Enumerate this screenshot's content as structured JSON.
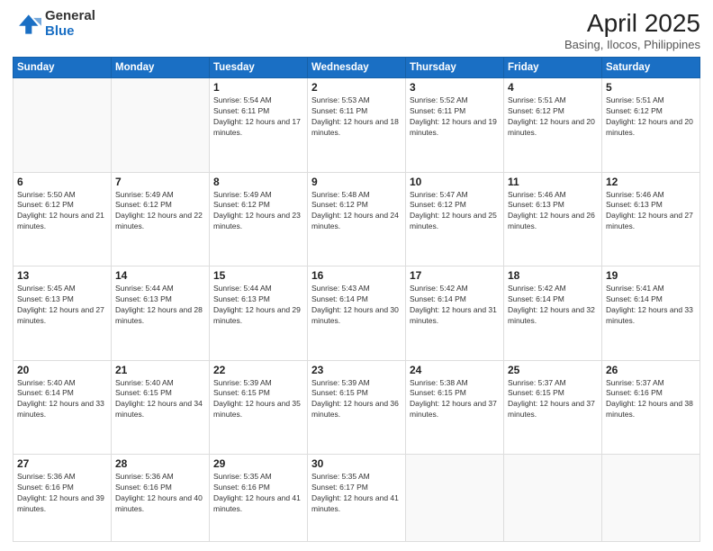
{
  "header": {
    "logo_general": "General",
    "logo_blue": "Blue",
    "title": "April 2025",
    "location": "Basing, Ilocos, Philippines"
  },
  "days_of_week": [
    "Sunday",
    "Monday",
    "Tuesday",
    "Wednesday",
    "Thursday",
    "Friday",
    "Saturday"
  ],
  "weeks": [
    [
      {
        "day": "",
        "detail": ""
      },
      {
        "day": "",
        "detail": ""
      },
      {
        "day": "1",
        "detail": "Sunrise: 5:54 AM\nSunset: 6:11 PM\nDaylight: 12 hours and 17 minutes."
      },
      {
        "day": "2",
        "detail": "Sunrise: 5:53 AM\nSunset: 6:11 PM\nDaylight: 12 hours and 18 minutes."
      },
      {
        "day": "3",
        "detail": "Sunrise: 5:52 AM\nSunset: 6:11 PM\nDaylight: 12 hours and 19 minutes."
      },
      {
        "day": "4",
        "detail": "Sunrise: 5:51 AM\nSunset: 6:12 PM\nDaylight: 12 hours and 20 minutes."
      },
      {
        "day": "5",
        "detail": "Sunrise: 5:51 AM\nSunset: 6:12 PM\nDaylight: 12 hours and 20 minutes."
      }
    ],
    [
      {
        "day": "6",
        "detail": "Sunrise: 5:50 AM\nSunset: 6:12 PM\nDaylight: 12 hours and 21 minutes."
      },
      {
        "day": "7",
        "detail": "Sunrise: 5:49 AM\nSunset: 6:12 PM\nDaylight: 12 hours and 22 minutes."
      },
      {
        "day": "8",
        "detail": "Sunrise: 5:49 AM\nSunset: 6:12 PM\nDaylight: 12 hours and 23 minutes."
      },
      {
        "day": "9",
        "detail": "Sunrise: 5:48 AM\nSunset: 6:12 PM\nDaylight: 12 hours and 24 minutes."
      },
      {
        "day": "10",
        "detail": "Sunrise: 5:47 AM\nSunset: 6:12 PM\nDaylight: 12 hours and 25 minutes."
      },
      {
        "day": "11",
        "detail": "Sunrise: 5:46 AM\nSunset: 6:13 PM\nDaylight: 12 hours and 26 minutes."
      },
      {
        "day": "12",
        "detail": "Sunrise: 5:46 AM\nSunset: 6:13 PM\nDaylight: 12 hours and 27 minutes."
      }
    ],
    [
      {
        "day": "13",
        "detail": "Sunrise: 5:45 AM\nSunset: 6:13 PM\nDaylight: 12 hours and 27 minutes."
      },
      {
        "day": "14",
        "detail": "Sunrise: 5:44 AM\nSunset: 6:13 PM\nDaylight: 12 hours and 28 minutes."
      },
      {
        "day": "15",
        "detail": "Sunrise: 5:44 AM\nSunset: 6:13 PM\nDaylight: 12 hours and 29 minutes."
      },
      {
        "day": "16",
        "detail": "Sunrise: 5:43 AM\nSunset: 6:14 PM\nDaylight: 12 hours and 30 minutes."
      },
      {
        "day": "17",
        "detail": "Sunrise: 5:42 AM\nSunset: 6:14 PM\nDaylight: 12 hours and 31 minutes."
      },
      {
        "day": "18",
        "detail": "Sunrise: 5:42 AM\nSunset: 6:14 PM\nDaylight: 12 hours and 32 minutes."
      },
      {
        "day": "19",
        "detail": "Sunrise: 5:41 AM\nSunset: 6:14 PM\nDaylight: 12 hours and 33 minutes."
      }
    ],
    [
      {
        "day": "20",
        "detail": "Sunrise: 5:40 AM\nSunset: 6:14 PM\nDaylight: 12 hours and 33 minutes."
      },
      {
        "day": "21",
        "detail": "Sunrise: 5:40 AM\nSunset: 6:15 PM\nDaylight: 12 hours and 34 minutes."
      },
      {
        "day": "22",
        "detail": "Sunrise: 5:39 AM\nSunset: 6:15 PM\nDaylight: 12 hours and 35 minutes."
      },
      {
        "day": "23",
        "detail": "Sunrise: 5:39 AM\nSunset: 6:15 PM\nDaylight: 12 hours and 36 minutes."
      },
      {
        "day": "24",
        "detail": "Sunrise: 5:38 AM\nSunset: 6:15 PM\nDaylight: 12 hours and 37 minutes."
      },
      {
        "day": "25",
        "detail": "Sunrise: 5:37 AM\nSunset: 6:15 PM\nDaylight: 12 hours and 37 minutes."
      },
      {
        "day": "26",
        "detail": "Sunrise: 5:37 AM\nSunset: 6:16 PM\nDaylight: 12 hours and 38 minutes."
      }
    ],
    [
      {
        "day": "27",
        "detail": "Sunrise: 5:36 AM\nSunset: 6:16 PM\nDaylight: 12 hours and 39 minutes."
      },
      {
        "day": "28",
        "detail": "Sunrise: 5:36 AM\nSunset: 6:16 PM\nDaylight: 12 hours and 40 minutes."
      },
      {
        "day": "29",
        "detail": "Sunrise: 5:35 AM\nSunset: 6:16 PM\nDaylight: 12 hours and 41 minutes."
      },
      {
        "day": "30",
        "detail": "Sunrise: 5:35 AM\nSunset: 6:17 PM\nDaylight: 12 hours and 41 minutes."
      },
      {
        "day": "",
        "detail": ""
      },
      {
        "day": "",
        "detail": ""
      },
      {
        "day": "",
        "detail": ""
      }
    ]
  ]
}
